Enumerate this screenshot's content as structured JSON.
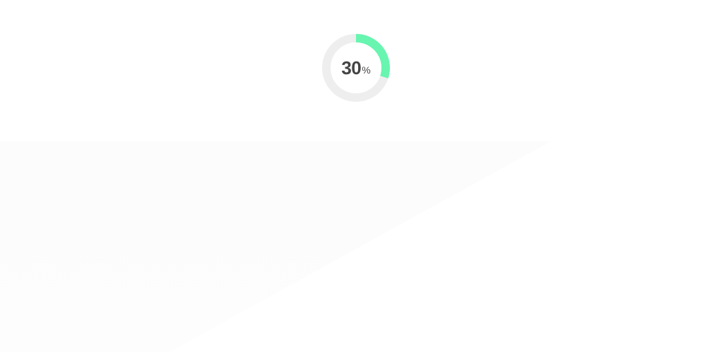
{
  "progress": {
    "value": "30",
    "unit": "%",
    "fraction": 0.3,
    "track_color": "#eeeeee",
    "fill_color": "#67f5b0"
  }
}
